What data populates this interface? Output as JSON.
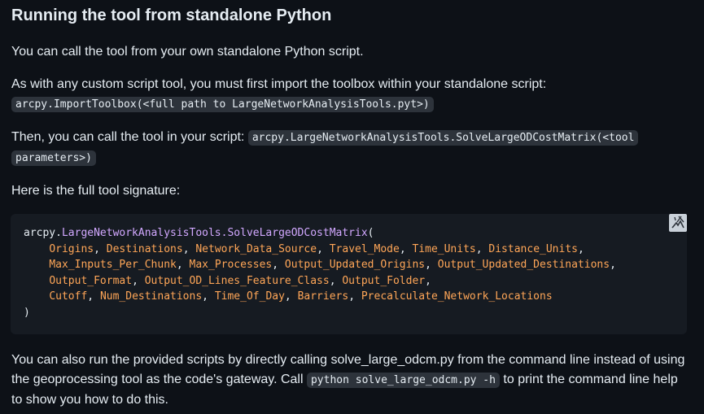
{
  "heading": "Running the tool from standalone Python",
  "para1": "You can call the tool from your own standalone Python script.",
  "para2": {
    "text": "As with any custom script tool, you must first import the toolbox within your standalone script:",
    "code": "arcpy.ImportToolbox(<full path to LargeNetworkAnalysisTools.pyt>)"
  },
  "para3": {
    "text": "Then, you can call the tool in your script:",
    "code_line1": "arcpy.LargeNetworkAnalysisTools.SolveLargeODCostMatrix(<tool",
    "code_line2": "parameters>)"
  },
  "para4": "Here is the full tool signature:",
  "codeblock": {
    "line1_prefix": "arcpy.",
    "line1_fn": "LargeNetworkAnalysisTools.SolveLargeODCostMatrix",
    "line1_suffix": "(",
    "params": [
      [
        "Origins",
        "Destinations",
        "Network_Data_Source",
        "Travel_Mode",
        "Time_Units",
        "Distance_Units"
      ],
      [
        "Max_Inputs_Per_Chunk",
        "Max_Processes",
        "Output_Updated_Origins",
        "Output_Updated_Destinations"
      ],
      [
        "Output_Format",
        "Output_OD_Lines_Feature_Class",
        "Output_Folder"
      ],
      [
        "Cutoff",
        "Num_Destinations",
        "Time_Of_Day",
        "Barriers",
        "Precalculate_Network_Locations"
      ]
    ],
    "closing": ")",
    "copy_icon": "broken-image-icon"
  },
  "para5": {
    "text_before": "You can also run the provided scripts by directly calling solve_large_odcm.py from the command line instead of using the geoprocessing tool as the code's gateway. Call",
    "code": "python solve_large_odcm.py -h",
    "text_after": "to print the command line help to show you how to do this."
  }
}
